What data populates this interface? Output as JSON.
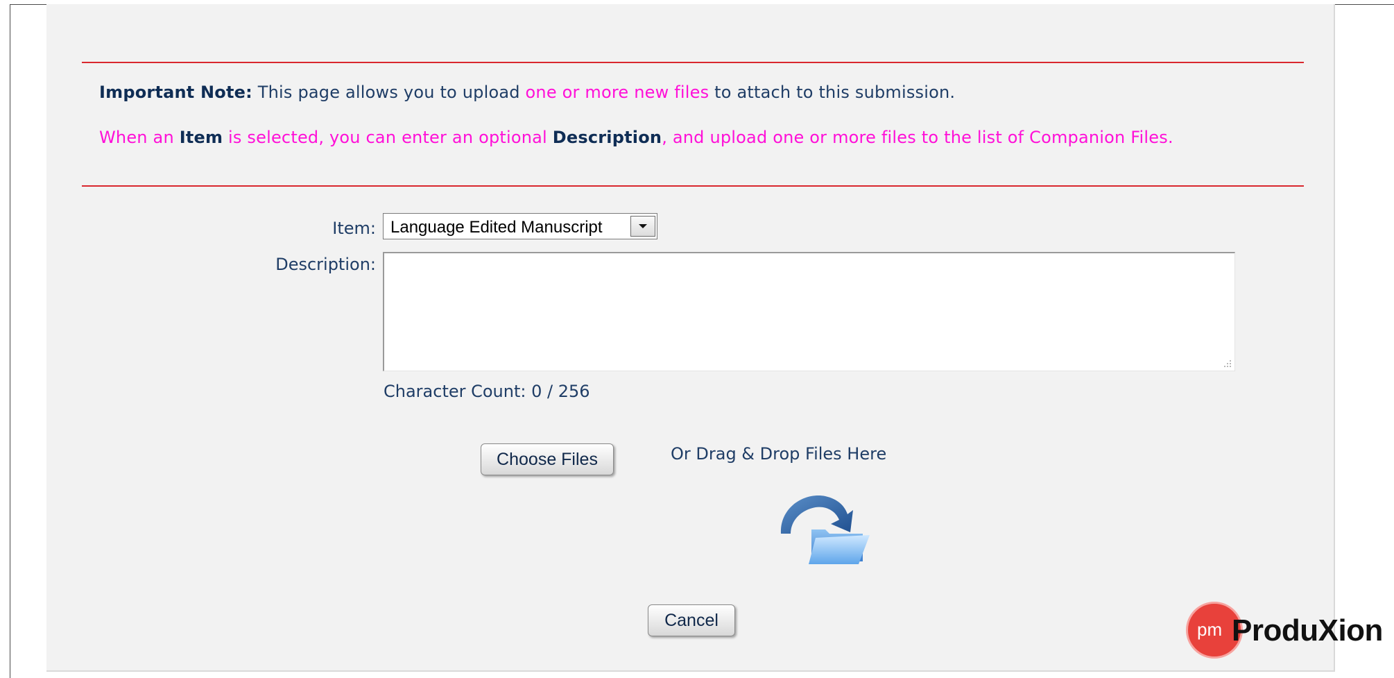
{
  "note": {
    "important_label": "Important Note:",
    "line1_pre": " This page allows you to upload ",
    "line1_highlight": "one or more new files",
    "line1_post": " to attach to this submission.",
    "line2_a": "When an ",
    "line2_item": "Item",
    "line2_b": " is selected, you can enter an optional ",
    "line2_description": "Description",
    "line2_c": ", and upload one or more files to the list of Companion Files."
  },
  "form": {
    "item_label": "Item:",
    "item_value": "Language Edited Manuscript",
    "description_label": "Description:",
    "description_value": "",
    "character_count": "Character Count: 0 / 256"
  },
  "upload": {
    "choose_files_label": "Choose Files",
    "drag_drop_text": "Or Drag & Drop Files Here",
    "drop_icon": "folder-arrow-icon"
  },
  "actions": {
    "cancel_label": "Cancel"
  },
  "branding": {
    "logo_mark": "pm",
    "logo_text": "ProduXion"
  },
  "colors": {
    "accent_rule": "#d9272e",
    "highlight_text": "#ff10d8",
    "body_text": "#1f3d66",
    "logo_red": "#e8413b"
  }
}
